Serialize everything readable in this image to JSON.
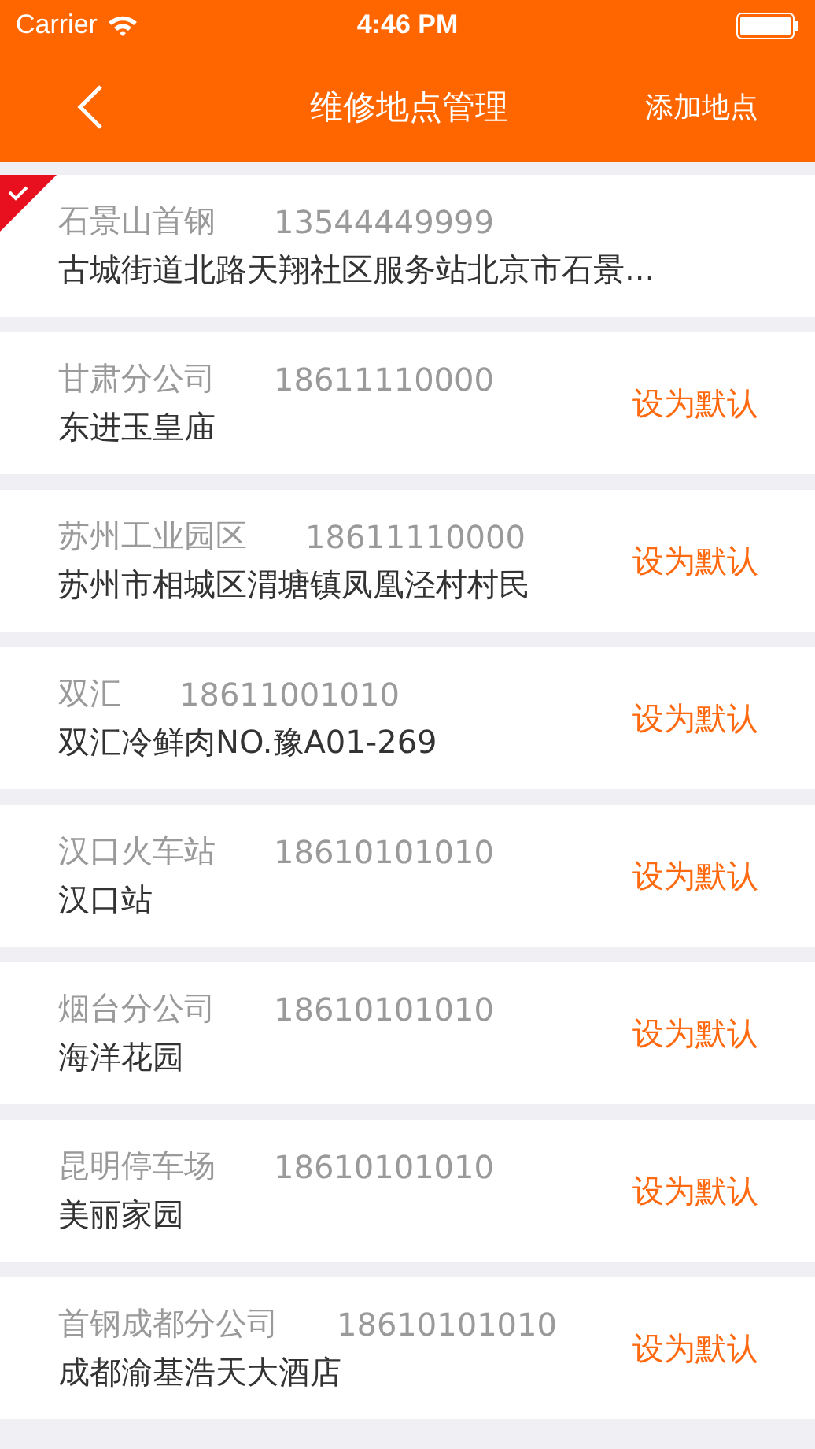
{
  "status_bar": {
    "carrier": "Carrier",
    "time": "4:46 PM"
  },
  "nav": {
    "title": "维修地点管理",
    "action": "添加地点"
  },
  "locations": [
    {
      "name": "石景山首钢",
      "phone": "13544449999",
      "address": "古城街道北路天翔社区服务站北京市石景...",
      "selected": true
    },
    {
      "name": "甘肃分公司",
      "phone": "18611110000",
      "address": "东进玉皇庙",
      "selected": false,
      "action": "设为默认"
    },
    {
      "name": "苏州工业园区",
      "phone": "18611110000",
      "address": "苏州市相城区渭塘镇凤凰泾村村民",
      "selected": false,
      "action": "设为默认"
    },
    {
      "name": "双汇",
      "phone": "18611001010",
      "address": "双汇冷鲜肉NO.豫A01-269",
      "selected": false,
      "action": "设为默认"
    },
    {
      "name": "汉口火车站",
      "phone": "18610101010",
      "address": "汉口站",
      "selected": false,
      "action": "设为默认"
    },
    {
      "name": "烟台分公司",
      "phone": "18610101010",
      "address": "海洋花园",
      "selected": false,
      "action": "设为默认"
    },
    {
      "name": "昆明停车场",
      "phone": "18610101010",
      "address": "美丽家园",
      "selected": false,
      "action": "设为默认"
    },
    {
      "name": "首钢成都分公司",
      "phone": "18610101010",
      "address": "成都渝基浩天大酒店",
      "selected": false,
      "action": "设为默认"
    }
  ]
}
